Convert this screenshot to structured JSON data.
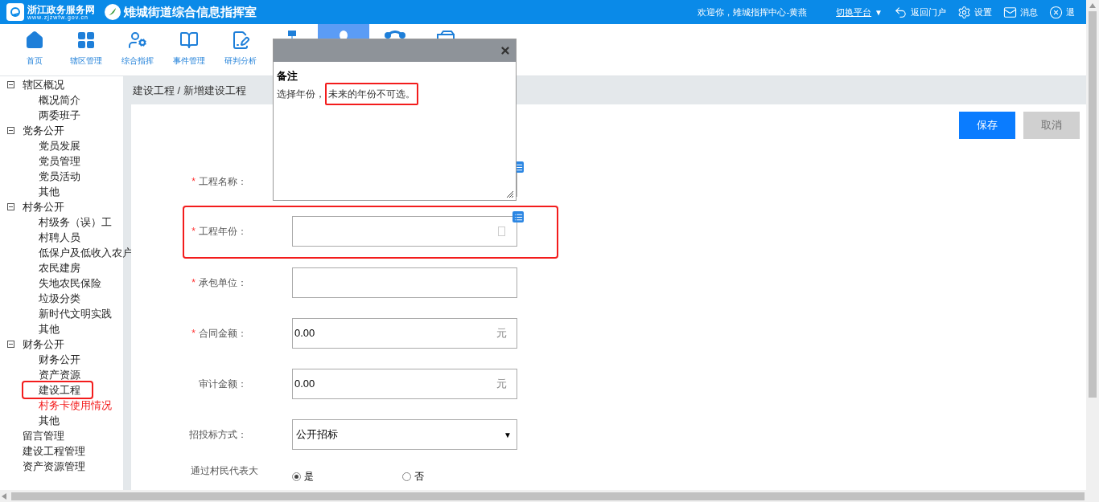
{
  "header": {
    "portal_name": "浙江政务服务网",
    "portal_url": "www.zjzwfw.gov.cn",
    "system_title": "雉城街道综合信息指挥室",
    "welcome": "欢迎你，雉城指挥中心-黄燕",
    "links": [
      {
        "kind": "switch",
        "label": "切换平台",
        "caret": "▼"
      },
      {
        "kind": "back",
        "label": "返回门户"
      },
      {
        "kind": "settings",
        "label": "设置"
      },
      {
        "kind": "message",
        "label": "消息"
      },
      {
        "kind": "logout",
        "label": "退"
      }
    ]
  },
  "nav": [
    {
      "kind": "home",
      "label": "首页",
      "selected": false
    },
    {
      "kind": "grid",
      "label": "辖区管理",
      "selected": false
    },
    {
      "kind": "officer",
      "label": "综合指挥",
      "selected": false
    },
    {
      "kind": "book",
      "label": "事件管理",
      "selected": false
    },
    {
      "kind": "report",
      "label": "研判分析",
      "selected": false
    },
    {
      "kind": "sitemap",
      "selected": false
    },
    {
      "kind": "user",
      "selected": true
    },
    {
      "kind": "share",
      "selected": false
    },
    {
      "kind": "car",
      "selected": false
    }
  ],
  "sidebar": [
    {
      "label": "辖区概况",
      "expanded": true,
      "children": [
        {
          "label": "概况简介",
          "marked": false,
          "alert": false
        },
        {
          "label": "两委班子",
          "marked": false,
          "alert": false
        }
      ]
    },
    {
      "label": "党务公开",
      "expanded": true,
      "children": [
        {
          "label": "党员发展",
          "marked": false,
          "alert": false
        },
        {
          "label": "党员管理",
          "marked": false,
          "alert": false
        },
        {
          "label": "党员活动",
          "marked": false,
          "alert": false
        },
        {
          "label": "其他",
          "marked": false,
          "alert": false
        }
      ]
    },
    {
      "label": "村务公开",
      "expanded": true,
      "children": [
        {
          "label": "村级务（误）工",
          "marked": false,
          "alert": false
        },
        {
          "label": "村聘人员",
          "marked": false,
          "alert": false
        },
        {
          "label": "低保户及低收入农户",
          "marked": false,
          "alert": false
        },
        {
          "label": "农民建房",
          "marked": false,
          "alert": false
        },
        {
          "label": "失地农民保险",
          "marked": false,
          "alert": false
        },
        {
          "label": "垃圾分类",
          "marked": false,
          "alert": false
        },
        {
          "label": "新时代文明实践",
          "marked": false,
          "alert": false
        },
        {
          "label": "其他",
          "marked": false,
          "alert": false
        }
      ]
    },
    {
      "label": "财务公开",
      "expanded": true,
      "children": [
        {
          "label": "财务公开",
          "marked": false,
          "alert": false
        },
        {
          "label": "资产资源",
          "marked": false,
          "alert": false
        },
        {
          "label": "建设工程",
          "marked": true,
          "alert": false
        },
        {
          "label": "村务卡使用情况",
          "marked": false,
          "alert": true
        },
        {
          "label": "其他",
          "marked": false,
          "alert": false
        }
      ]
    },
    {
      "label": "留言管理"
    },
    {
      "label": "建设工程管理"
    },
    {
      "label": "资产资源管理"
    }
  ],
  "breadcrumb": "建设工程 / 新增建设工程",
  "actions": [
    {
      "label": "保存",
      "disabled": false
    },
    {
      "label": "取消",
      "disabled": true
    }
  ],
  "form": [
    {
      "kind": "text",
      "marker": "*",
      "label": "工程名称：",
      "note": true,
      "marked": false
    },
    {
      "kind": "date",
      "marker": "*",
      "label": "工程年份：",
      "note": true,
      "marked": true
    },
    {
      "kind": "text",
      "marker": "*",
      "label": "承包单位：",
      "note": false,
      "marked": false
    },
    {
      "kind": "money",
      "marker": "*",
      "label": "合同金额：",
      "note": false,
      "marked": false,
      "value": "0.00",
      "unit": "元"
    },
    {
      "kind": "money",
      "label": "审计金额：",
      "note": false,
      "marked": false,
      "value": "0.00",
      "unit": "元"
    },
    {
      "kind": "select",
      "label": "招投标方式：",
      "note": false,
      "marked": false,
      "value": "公开招标",
      "caret": "▼"
    },
    {
      "kind": "radio",
      "label": "通过村民代表大",
      "note": false,
      "marked": false,
      "options": [
        {
          "label": "是",
          "selected": true
        },
        {
          "label": "否",
          "selected": false
        }
      ]
    }
  ],
  "popup": {
    "title": "备注",
    "parts": [
      {
        "text": "选择年份，",
        "marked": false
      },
      {
        "text": "未来的年份不可选。",
        "marked": true
      }
    ]
  }
}
